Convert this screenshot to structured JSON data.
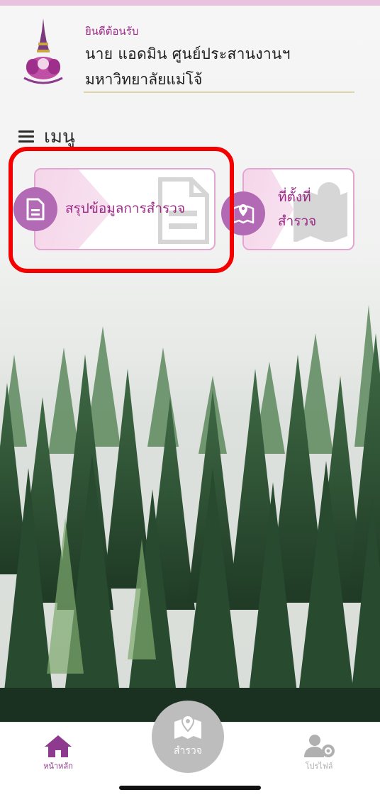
{
  "header": {
    "welcome": "ยินดีต้อนรับ",
    "user_name": "นาย แอดมิน ศูนย์ประสานงานฯ",
    "university": "มหาวิทยาลัยแม่โจ้"
  },
  "menu": {
    "title": "เมนู",
    "cards": [
      {
        "label": "สรุปข้อมูลการสำรวจ",
        "icon": "document-icon"
      },
      {
        "label_line1": "ที่ตั้งที่",
        "label_line2": "สำรวจ",
        "icon": "map-pin-icon"
      }
    ]
  },
  "bottom_nav": {
    "home_label": "หน้าหลัก",
    "survey_label": "สำรวจ",
    "profile_label": "โปรไฟล์"
  },
  "colors": {
    "accent": "#9b2a86",
    "icon_circle": "#b36ab4",
    "card_border": "#e3a6d2",
    "highlight": "#f50000",
    "home_icon": "#8e3b8f"
  }
}
